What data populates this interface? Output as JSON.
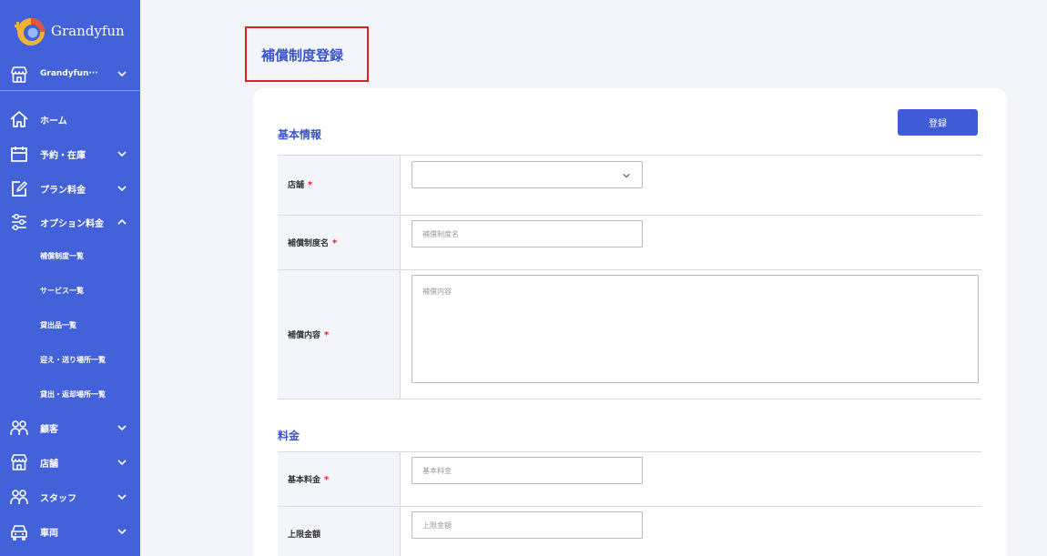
{
  "sidebar": {
    "brand": "Grandyfun",
    "store": "Grandyfun···",
    "nav": [
      {
        "label": "ホーム"
      },
      {
        "label": "予約・在庫"
      },
      {
        "label": "プラン料金"
      },
      {
        "label": "オプション料金"
      },
      {
        "label": "顧客"
      },
      {
        "label": "店舗"
      },
      {
        "label": "スタッフ"
      },
      {
        "label": "車両"
      }
    ],
    "sub": [
      {
        "label": "補償制度一覧"
      },
      {
        "label": "サービス一覧"
      },
      {
        "label": "貸出品一覧"
      },
      {
        "label": "迎え・送り場所一覧"
      },
      {
        "label": "貸出・返却場所一覧"
      }
    ]
  },
  "header": {
    "title": "補償制度登録"
  },
  "form": {
    "submit_label": "登録",
    "basic_section": "基本情報",
    "price_section": "料金",
    "required_mark": "*",
    "fields": {
      "store": {
        "label": "店舗",
        "value": ""
      },
      "name": {
        "label": "補償制度名",
        "placeholder": "補償制度名"
      },
      "content": {
        "label": "補償内容",
        "placeholder": "補償内容"
      },
      "base_price": {
        "label": "基本料金",
        "placeholder": "基本料金"
      },
      "max_price": {
        "label": "上限金額",
        "placeholder": "上限金額"
      }
    }
  },
  "colors": {
    "accent": "#4361d8",
    "required": "#e02020",
    "title": "#3a55c8"
  }
}
